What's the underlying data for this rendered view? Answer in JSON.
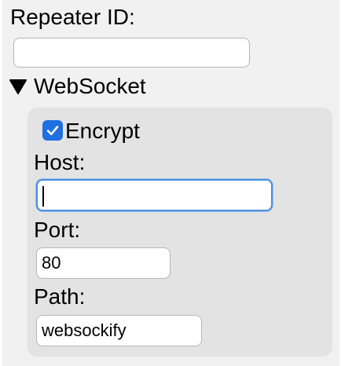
{
  "repeater_id": {
    "label": "Repeater ID:",
    "value": ""
  },
  "websocket": {
    "label": "WebSocket",
    "expanded": true,
    "encrypt": {
      "label": "Encrypt",
      "checked": true
    },
    "host": {
      "label": "Host:",
      "value": ""
    },
    "port": {
      "label": "Port:",
      "value": "80"
    },
    "path": {
      "label": "Path:",
      "value": "websockify"
    }
  },
  "colors": {
    "panel_bg": "#f1f1f1",
    "subpanel_bg": "#e3e3e3",
    "focus_ring": "#4a90e2",
    "checkbox": "#1f6fe0"
  },
  "icons": {
    "disclosure": "triangle-down-icon",
    "checkmark": "checkmark-icon"
  }
}
